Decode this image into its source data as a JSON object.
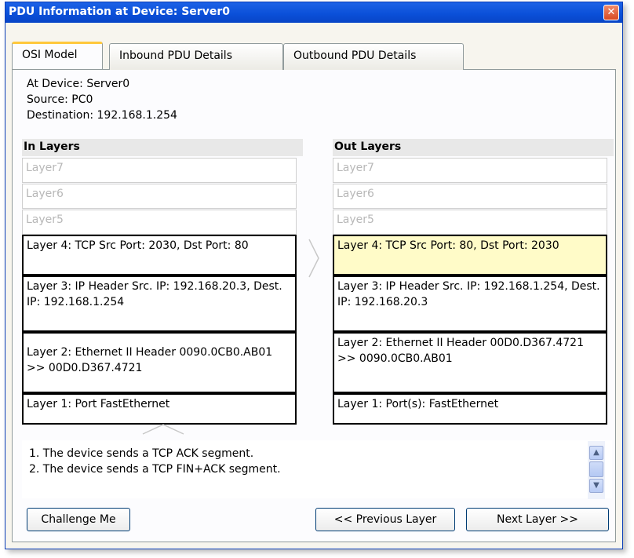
{
  "window": {
    "title": "PDU Information at Device: Server0",
    "close_icon": "close-icon",
    "accent": "#0a4fd8"
  },
  "tabs": [
    {
      "label": "OSI Model",
      "active": true
    },
    {
      "label": "Inbound PDU Details",
      "active": false
    },
    {
      "label": "Outbound PDU Details",
      "active": false
    }
  ],
  "info": {
    "device": "At Device: Server0",
    "source": "Source: PC0",
    "destination": "Destination: 192.168.1.254"
  },
  "in_layers": {
    "header": "In Layers",
    "items": [
      {
        "text": "Layer7",
        "state": "disabled"
      },
      {
        "text": "Layer6",
        "state": "disabled"
      },
      {
        "text": "Layer5",
        "state": "disabled"
      },
      {
        "text": "Layer 4: TCP Src Port: 2030, Dst Port: 80",
        "state": "active"
      },
      {
        "text": "Layer 3: IP Header Src. IP: 192.168.20.3, Dest. IP: 192.168.1.254",
        "state": "active"
      },
      {
        "text": "Layer 2: Ethernet II Header 0090.0CB0.AB01 >> 00D0.D367.4721",
        "state": "active"
      },
      {
        "text": "Layer 1: Port FastEthernet",
        "state": "active"
      }
    ]
  },
  "out_layers": {
    "header": "Out Layers",
    "items": [
      {
        "text": "Layer7",
        "state": "disabled"
      },
      {
        "text": "Layer6",
        "state": "disabled"
      },
      {
        "text": "Layer5",
        "state": "disabled"
      },
      {
        "text": "Layer 4: TCP Src Port: 80, Dst Port: 2030",
        "state": "highlight"
      },
      {
        "text": "Layer 3: IP Header Src. IP: 192.168.1.254, Dest. IP: 192.168.20.3",
        "state": "active"
      },
      {
        "text": "Layer 2: Ethernet II Header 00D0.D367.4721 >> 0090.0CB0.AB01",
        "state": "active"
      },
      {
        "text": "Layer 1: Port(s): FastEthernet",
        "state": "active"
      }
    ]
  },
  "description": {
    "lines": [
      "1. The device sends a TCP ACK segment.",
      "2. The device sends a TCP FIN+ACK segment."
    ]
  },
  "buttons": {
    "challenge": "Challenge Me",
    "previous": "<< Previous Layer",
    "next": "Next Layer >>"
  }
}
